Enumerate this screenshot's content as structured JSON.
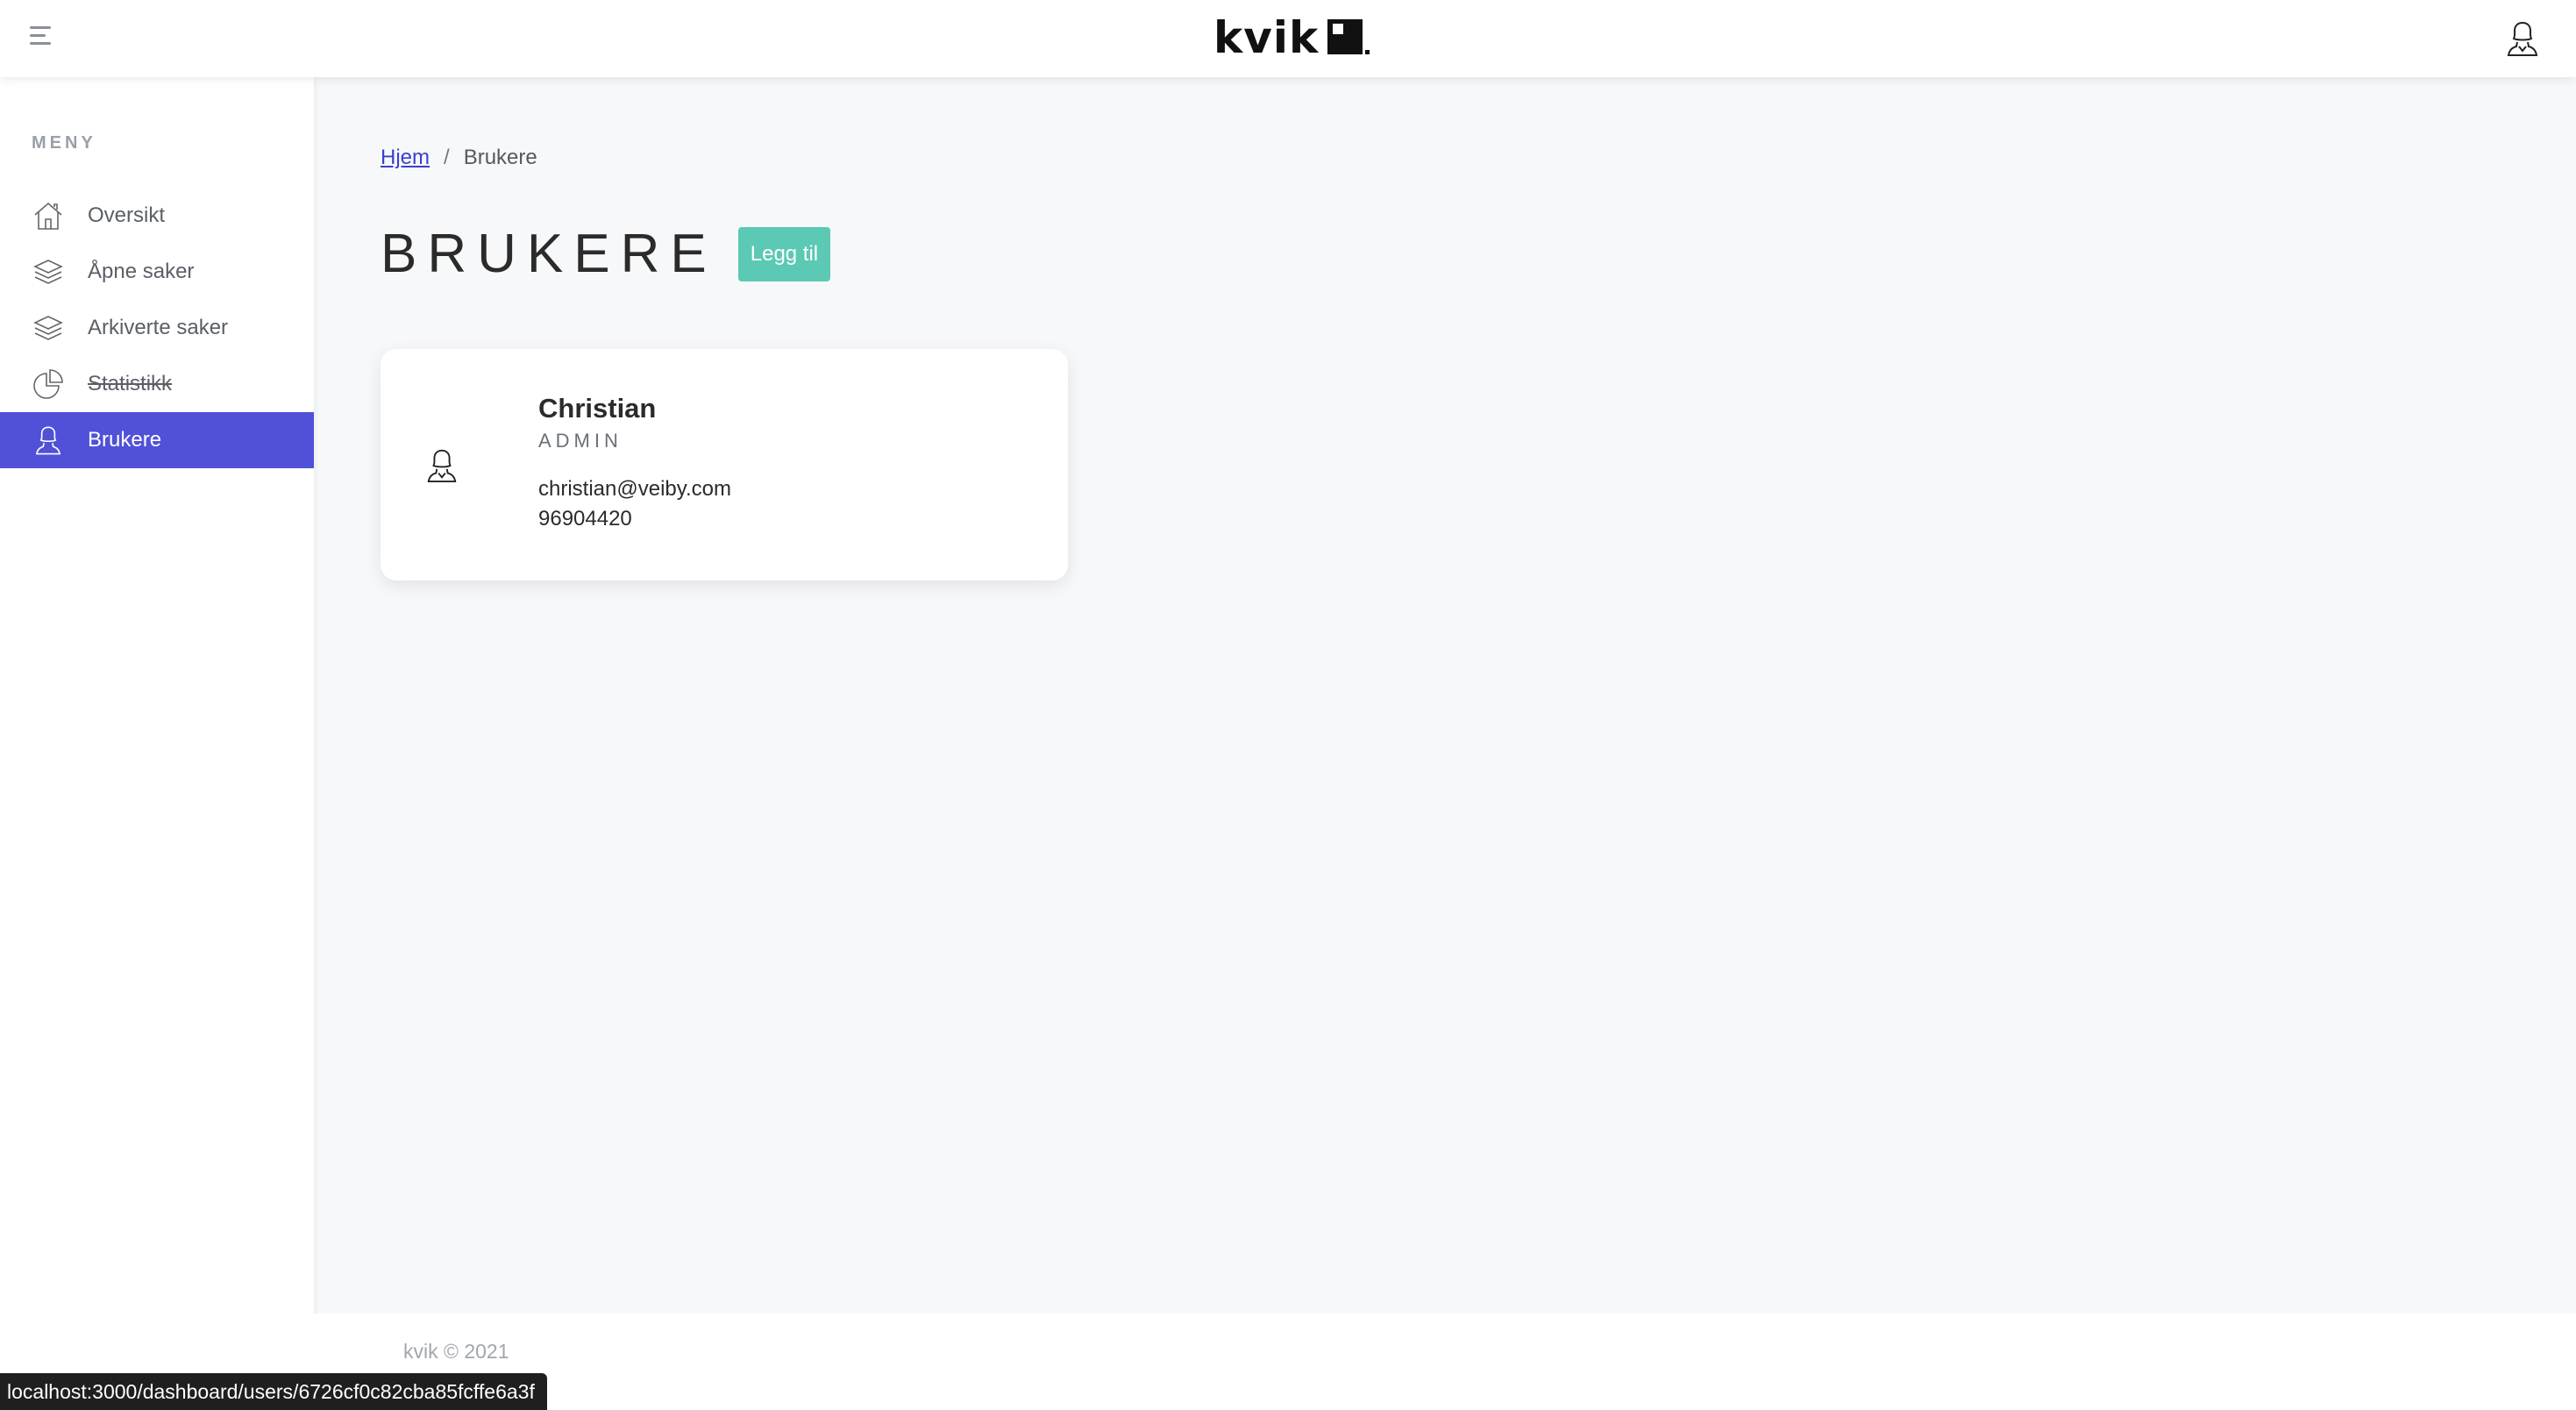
{
  "header": {
    "logo_text": "kvik",
    "menu_icon": "hamburger-icon",
    "user_icon": "user-icon"
  },
  "sidebar": {
    "heading": "MENY",
    "items": [
      {
        "label": "Oversikt",
        "icon": "home-icon",
        "active": false,
        "strike": false
      },
      {
        "label": "Åpne saker",
        "icon": "layers-icon",
        "active": false,
        "strike": false
      },
      {
        "label": "Arkiverte saker",
        "icon": "layers-icon",
        "active": false,
        "strike": false
      },
      {
        "label": "Statistikk",
        "icon": "pie-chart-icon",
        "active": false,
        "strike": true
      },
      {
        "label": "Brukere",
        "icon": "user-icon",
        "active": true,
        "strike": false
      }
    ]
  },
  "breadcrumb": {
    "home": "Hjem",
    "separator": "/",
    "current": "Brukere"
  },
  "page": {
    "title": "BRUKERE",
    "add_button": "Legg til"
  },
  "users": [
    {
      "name": "Christian",
      "role": "ADMIN",
      "email": "christian@veiby.com",
      "phone": "96904420"
    }
  ],
  "footer": {
    "text": "kvik © 2021"
  },
  "status_bar": {
    "url": "localhost:3000/dashboard/users/6726cf0c82cba85fcffe6a3f"
  },
  "colors": {
    "accent": "#5051d8",
    "button": "#5bc9b4",
    "background": "#f7f8fa"
  }
}
